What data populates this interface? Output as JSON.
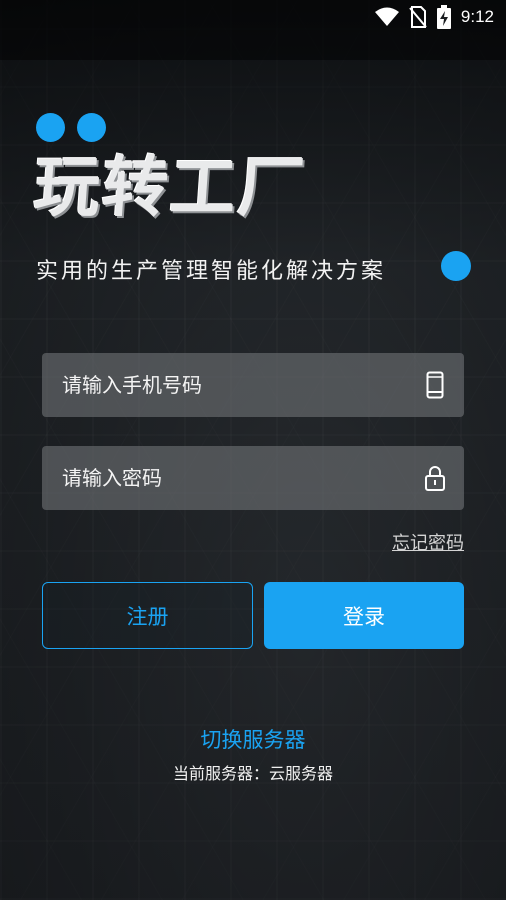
{
  "status_bar": {
    "time": "9:12",
    "icons": [
      "wifi-icon",
      "no-sim-icon",
      "battery-charging-icon"
    ]
  },
  "brand": {
    "logo_text": "玩转工厂",
    "slogan": "实用的生产管理智能化解决方案",
    "accent_color": "#1aa3f2"
  },
  "login_form": {
    "phone_placeholder": "请输入手机号码",
    "password_placeholder": "请输入密码",
    "phone_icon": "mobile-phone-icon",
    "password_icon": "lock-icon",
    "forgot_password": "忘记密码"
  },
  "actions": {
    "register_label": "注册",
    "login_label": "登录"
  },
  "server": {
    "switch_label": "切换服务器",
    "current_label": "当前服务器：云服务器"
  }
}
